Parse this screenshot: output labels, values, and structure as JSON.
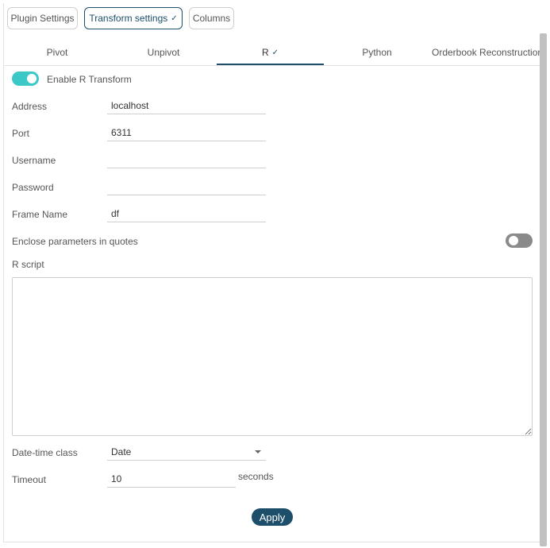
{
  "top_buttons": [
    {
      "label": "Plugin Settings",
      "active": false
    },
    {
      "label": "Transform settings",
      "active": true
    },
    {
      "label": "Columns",
      "active": false
    }
  ],
  "tabs": [
    {
      "label": "Pivot",
      "active": false
    },
    {
      "label": "Unpivot",
      "active": false
    },
    {
      "label": "R",
      "active": true
    },
    {
      "label": "Python",
      "active": false
    },
    {
      "label": "Orderbook Reconstruction",
      "active": false
    }
  ],
  "enable_r": {
    "label": "Enable R Transform",
    "enabled": true
  },
  "fields": {
    "address": {
      "label": "Address",
      "value": "localhost"
    },
    "port": {
      "label": "Port",
      "value": "6311"
    },
    "username": {
      "label": "Username",
      "value": ""
    },
    "password": {
      "label": "Password",
      "value": ""
    },
    "frame_name": {
      "label": "Frame Name",
      "value": "df"
    }
  },
  "enclose": {
    "label": "Enclose parameters in quotes",
    "enabled": false
  },
  "r_script": {
    "label": "R script",
    "value": ""
  },
  "datetime": {
    "label": "Date-time class",
    "value": "Date"
  },
  "timeout": {
    "label": "Timeout",
    "value": "10",
    "unit": "seconds"
  },
  "apply_label": "Apply",
  "colors": {
    "accent": "#1d4f6b",
    "toggle_on": "#3cc8c7",
    "toggle_off": "#8a8a8a"
  }
}
